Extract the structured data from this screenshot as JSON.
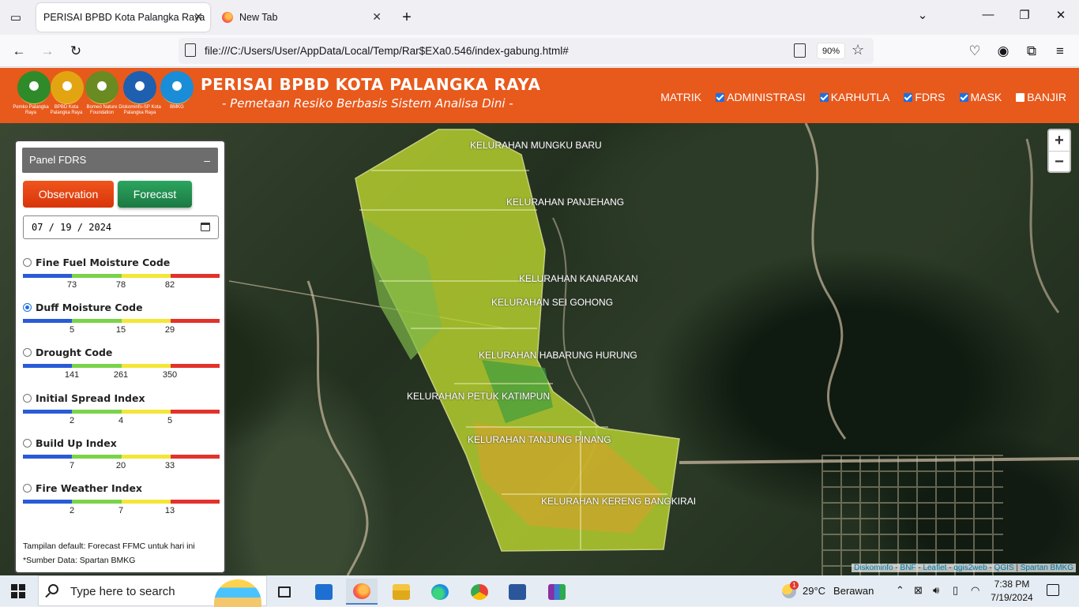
{
  "browser": {
    "tabs": [
      {
        "title": "PERISAI BPBD Kota Palangka Raya",
        "active": true
      },
      {
        "title": "New Tab",
        "active": false
      }
    ],
    "url": "file:///C:/Users/User/AppData/Local/Temp/Rar$EXa0.546/index-gabung.html#",
    "zoom": "90%"
  },
  "header": {
    "title": "PERISAI BPBD KOTA PALANGKA RAYA",
    "subtitle": "- Pemetaan Resiko Berbasis Sistem Analisa Dini -",
    "logos": [
      {
        "caption": "Pemko Palangka Raya",
        "color": "#2f8a2a"
      },
      {
        "caption": "BPBD Kota Palangka Raya",
        "color": "#e3a412"
      },
      {
        "caption": "Borneo Nature Foundation",
        "color": "#6a8a22"
      },
      {
        "caption": "Diskominfo-SP Kota Palangka Raya",
        "color": "#1f5fb0"
      },
      {
        "caption": "BMKG",
        "color": "#1a8dd8"
      }
    ],
    "menu": [
      {
        "label": "MATRIK",
        "checkbox": false,
        "checked": false
      },
      {
        "label": "ADMINISTRASI",
        "checkbox": true,
        "checked": true
      },
      {
        "label": "KARHUTLA",
        "checkbox": true,
        "checked": true
      },
      {
        "label": "FDRS",
        "checkbox": true,
        "checked": true
      },
      {
        "label": "MASK",
        "checkbox": true,
        "checked": true
      },
      {
        "label": "BANJIR",
        "checkbox": true,
        "checked": false
      }
    ]
  },
  "panel": {
    "title": "Panel FDRS",
    "minimize": "–",
    "observation_label": "Observation",
    "forecast_label": "Forecast",
    "date": "07 / 19 / 2024",
    "scale_colors": [
      "#2a5bd7",
      "#7bd349",
      "#f4e637",
      "#e2322b"
    ],
    "indices": [
      {
        "name": "Fine Fuel Moisture Code",
        "selected": false,
        "ticks": [
          "73",
          "78",
          "82"
        ]
      },
      {
        "name": "Duff Moisture Code",
        "selected": true,
        "ticks": [
          "5",
          "15",
          "29"
        ]
      },
      {
        "name": "Drought Code",
        "selected": false,
        "ticks": [
          "141",
          "261",
          "350"
        ]
      },
      {
        "name": "Initial Spread Index",
        "selected": false,
        "ticks": [
          "2",
          "4",
          "5"
        ]
      },
      {
        "name": "Build Up Index",
        "selected": false,
        "ticks": [
          "7",
          "20",
          "33"
        ]
      },
      {
        "name": "Fire Weather Index",
        "selected": false,
        "ticks": [
          "2",
          "7",
          "13"
        ]
      }
    ],
    "note_default": "Tampilan default: Forecast FFMC untuk hari ini",
    "note_source": "*Sumber Data: Spartan BMKG"
  },
  "map": {
    "labels": [
      "KELURAHAN MUNGKU BARU",
      "KELURAHAN PANJEHANG",
      "KELURAHAN KANARAKAN",
      "KELURAHAN SEI GOHONG",
      "KELURAHAN HABARUNG HURUNG",
      "KELURAHAN PETUK KATIMPUN",
      "KELURAHAN TANJUNG PINANG",
      "KELURAHAN KERENG BANGKIRAI"
    ],
    "zoom_in": "+",
    "zoom_out": "−",
    "attribution": [
      "Diskominfo",
      "BNF",
      "Leaflet",
      "qgis2web",
      "QGIS",
      "Spartan BMKG"
    ]
  },
  "taskbar": {
    "search_placeholder": "Type here to search",
    "weather_temp": "29°C",
    "weather_desc": "Berawan",
    "weather_badge": "1",
    "time": "7:38 PM",
    "date": "7/19/2024"
  }
}
